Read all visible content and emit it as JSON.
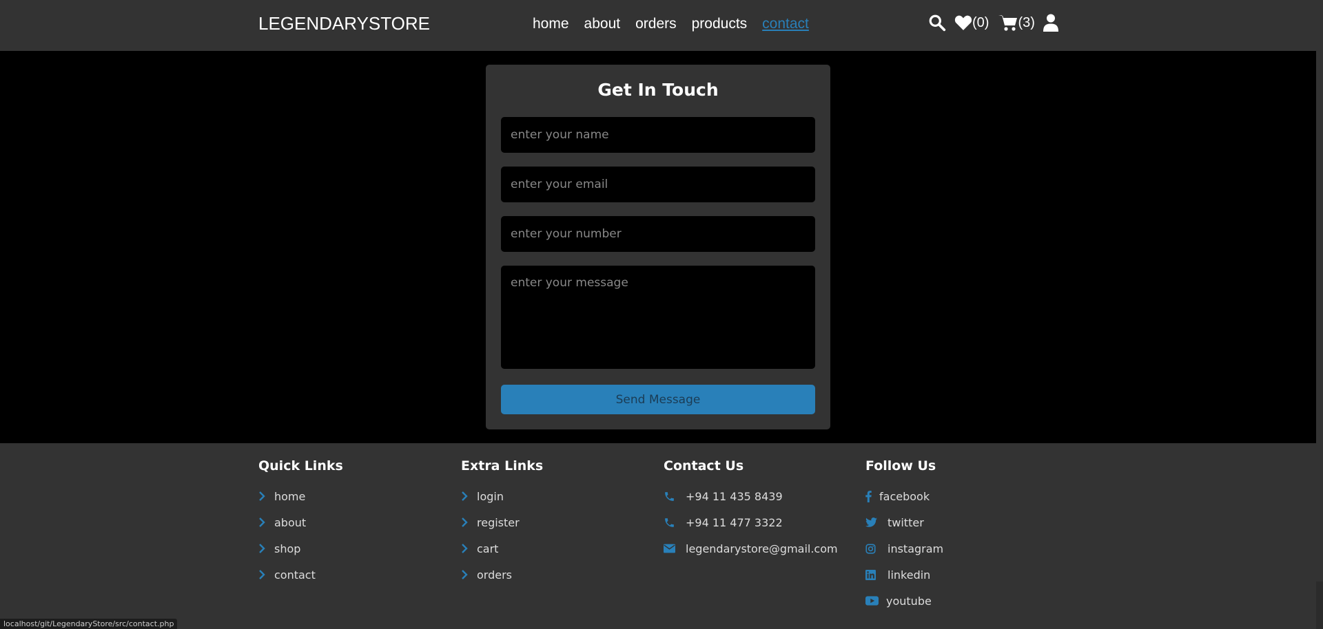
{
  "header": {
    "logo": "LEGENDARYSTORE",
    "nav": [
      {
        "label": "home"
      },
      {
        "label": "about"
      },
      {
        "label": "orders"
      },
      {
        "label": "products"
      },
      {
        "label": "contact",
        "active": true
      }
    ],
    "wishlist_count": "(0)",
    "cart_count": "(3)",
    "icons": [
      "search-icon",
      "heart-icon",
      "cart-icon",
      "user-icon"
    ]
  },
  "contact_form": {
    "title": "Get In Touch",
    "name_placeholder": "enter your name",
    "email_placeholder": "enter your email",
    "number_placeholder": "enter your number",
    "message_placeholder": "enter your message",
    "submit_label": "Send Message"
  },
  "footer": {
    "quick_links": {
      "title": "Quick Links",
      "items": [
        "home",
        "about",
        "shop",
        "contact"
      ]
    },
    "extra_links": {
      "title": "Extra Links",
      "items": [
        "login",
        "register",
        "cart",
        "orders"
      ]
    },
    "contact_us": {
      "title": "Contact Us",
      "items": [
        {
          "icon": "phone-icon",
          "text": "+94 11 435 8439"
        },
        {
          "icon": "phone-icon",
          "text": "+94 11 477 3322"
        },
        {
          "icon": "envelope-icon",
          "text": "legendarystore@gmail.com"
        }
      ]
    },
    "follow_us": {
      "title": "Follow Us",
      "items": [
        {
          "icon": "facebook-icon",
          "text": "facebook"
        },
        {
          "icon": "twitter-icon",
          "text": "twitter"
        },
        {
          "icon": "instagram-icon",
          "text": "instagram"
        },
        {
          "icon": "linkedin-icon",
          "text": "linkedin"
        },
        {
          "icon": "youtube-icon",
          "text": "youtube"
        }
      ]
    }
  },
  "status_bar": {
    "url": "localhost/git/LegendaryStore/src/contact.php"
  },
  "colors": {
    "accent": "#2980b9",
    "panel": "#333333",
    "background": "#000000"
  }
}
